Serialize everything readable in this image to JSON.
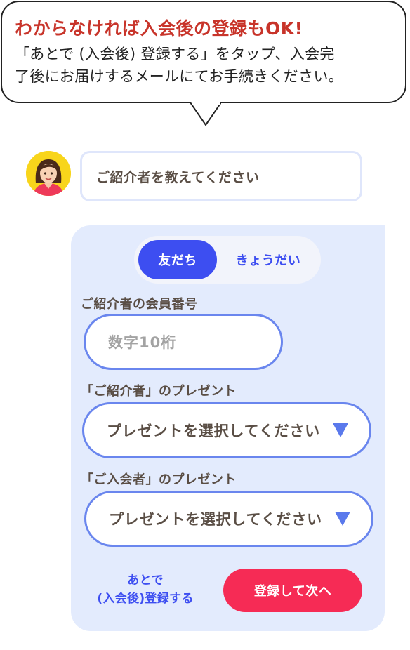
{
  "bubble": {
    "title": "わからなければ入会後の登録もOK!",
    "line1": "「あとで (入会後) 登録する」をタップ、入会完",
    "line2": "了後にお届けするメールにてお手続きください。"
  },
  "question": {
    "text": "ご紹介者を教えてください"
  },
  "toggle": {
    "option_active": "友だち",
    "option_inactive": "きょうだい"
  },
  "member_number": {
    "label": "ご紹介者の会員番号",
    "placeholder": "数字10桁"
  },
  "referrer_gift": {
    "label": "「ご紹介者」のプレゼント",
    "value": "プレゼントを選択してください"
  },
  "newcomer_gift": {
    "label": "「ご入会者」のプレゼント",
    "value": "プレゼントを選択してください"
  },
  "actions": {
    "later_line1": "あとで",
    "later_line2": "(入会後)登録する",
    "next": "登録して次へ"
  },
  "colors": {
    "accent_blue": "#3d4ef1",
    "cta_red": "#f62b55",
    "title_red": "#c8342a",
    "panel_bg": "#e3ebfd"
  }
}
